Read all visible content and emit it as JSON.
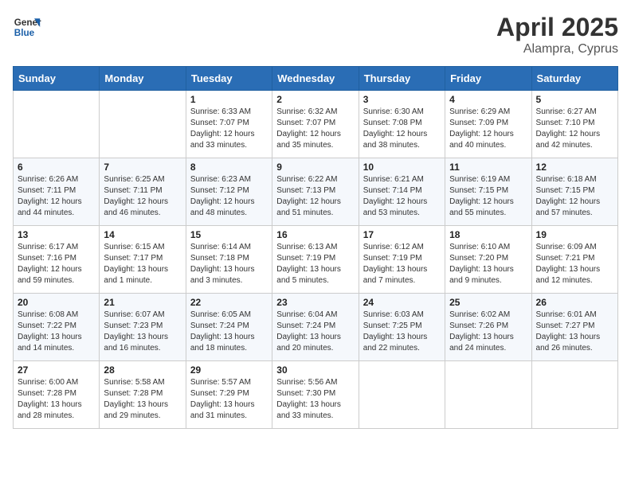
{
  "header": {
    "logo_line1": "General",
    "logo_line2": "Blue",
    "month_year": "April 2025",
    "location": "Alampra, Cyprus"
  },
  "days_of_week": [
    "Sunday",
    "Monday",
    "Tuesday",
    "Wednesday",
    "Thursday",
    "Friday",
    "Saturday"
  ],
  "weeks": [
    [
      {
        "day": "",
        "info": ""
      },
      {
        "day": "",
        "info": ""
      },
      {
        "day": "1",
        "info": "Sunrise: 6:33 AM\nSunset: 7:07 PM\nDaylight: 12 hours and 33 minutes."
      },
      {
        "day": "2",
        "info": "Sunrise: 6:32 AM\nSunset: 7:07 PM\nDaylight: 12 hours and 35 minutes."
      },
      {
        "day": "3",
        "info": "Sunrise: 6:30 AM\nSunset: 7:08 PM\nDaylight: 12 hours and 38 minutes."
      },
      {
        "day": "4",
        "info": "Sunrise: 6:29 AM\nSunset: 7:09 PM\nDaylight: 12 hours and 40 minutes."
      },
      {
        "day": "5",
        "info": "Sunrise: 6:27 AM\nSunset: 7:10 PM\nDaylight: 12 hours and 42 minutes."
      }
    ],
    [
      {
        "day": "6",
        "info": "Sunrise: 6:26 AM\nSunset: 7:11 PM\nDaylight: 12 hours and 44 minutes."
      },
      {
        "day": "7",
        "info": "Sunrise: 6:25 AM\nSunset: 7:11 PM\nDaylight: 12 hours and 46 minutes."
      },
      {
        "day": "8",
        "info": "Sunrise: 6:23 AM\nSunset: 7:12 PM\nDaylight: 12 hours and 48 minutes."
      },
      {
        "day": "9",
        "info": "Sunrise: 6:22 AM\nSunset: 7:13 PM\nDaylight: 12 hours and 51 minutes."
      },
      {
        "day": "10",
        "info": "Sunrise: 6:21 AM\nSunset: 7:14 PM\nDaylight: 12 hours and 53 minutes."
      },
      {
        "day": "11",
        "info": "Sunrise: 6:19 AM\nSunset: 7:15 PM\nDaylight: 12 hours and 55 minutes."
      },
      {
        "day": "12",
        "info": "Sunrise: 6:18 AM\nSunset: 7:15 PM\nDaylight: 12 hours and 57 minutes."
      }
    ],
    [
      {
        "day": "13",
        "info": "Sunrise: 6:17 AM\nSunset: 7:16 PM\nDaylight: 12 hours and 59 minutes."
      },
      {
        "day": "14",
        "info": "Sunrise: 6:15 AM\nSunset: 7:17 PM\nDaylight: 13 hours and 1 minute."
      },
      {
        "day": "15",
        "info": "Sunrise: 6:14 AM\nSunset: 7:18 PM\nDaylight: 13 hours and 3 minutes."
      },
      {
        "day": "16",
        "info": "Sunrise: 6:13 AM\nSunset: 7:19 PM\nDaylight: 13 hours and 5 minutes."
      },
      {
        "day": "17",
        "info": "Sunrise: 6:12 AM\nSunset: 7:19 PM\nDaylight: 13 hours and 7 minutes."
      },
      {
        "day": "18",
        "info": "Sunrise: 6:10 AM\nSunset: 7:20 PM\nDaylight: 13 hours and 9 minutes."
      },
      {
        "day": "19",
        "info": "Sunrise: 6:09 AM\nSunset: 7:21 PM\nDaylight: 13 hours and 12 minutes."
      }
    ],
    [
      {
        "day": "20",
        "info": "Sunrise: 6:08 AM\nSunset: 7:22 PM\nDaylight: 13 hours and 14 minutes."
      },
      {
        "day": "21",
        "info": "Sunrise: 6:07 AM\nSunset: 7:23 PM\nDaylight: 13 hours and 16 minutes."
      },
      {
        "day": "22",
        "info": "Sunrise: 6:05 AM\nSunset: 7:24 PM\nDaylight: 13 hours and 18 minutes."
      },
      {
        "day": "23",
        "info": "Sunrise: 6:04 AM\nSunset: 7:24 PM\nDaylight: 13 hours and 20 minutes."
      },
      {
        "day": "24",
        "info": "Sunrise: 6:03 AM\nSunset: 7:25 PM\nDaylight: 13 hours and 22 minutes."
      },
      {
        "day": "25",
        "info": "Sunrise: 6:02 AM\nSunset: 7:26 PM\nDaylight: 13 hours and 24 minutes."
      },
      {
        "day": "26",
        "info": "Sunrise: 6:01 AM\nSunset: 7:27 PM\nDaylight: 13 hours and 26 minutes."
      }
    ],
    [
      {
        "day": "27",
        "info": "Sunrise: 6:00 AM\nSunset: 7:28 PM\nDaylight: 13 hours and 28 minutes."
      },
      {
        "day": "28",
        "info": "Sunrise: 5:58 AM\nSunset: 7:28 PM\nDaylight: 13 hours and 29 minutes."
      },
      {
        "day": "29",
        "info": "Sunrise: 5:57 AM\nSunset: 7:29 PM\nDaylight: 13 hours and 31 minutes."
      },
      {
        "day": "30",
        "info": "Sunrise: 5:56 AM\nSunset: 7:30 PM\nDaylight: 13 hours and 33 minutes."
      },
      {
        "day": "",
        "info": ""
      },
      {
        "day": "",
        "info": ""
      },
      {
        "day": "",
        "info": ""
      }
    ]
  ]
}
